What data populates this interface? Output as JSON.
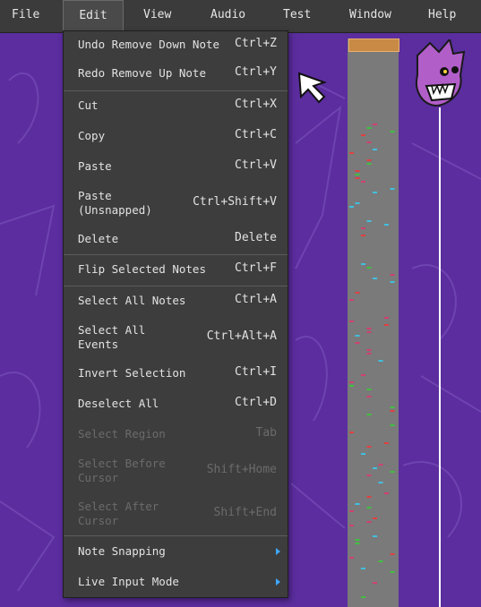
{
  "menubar": {
    "items": [
      "File",
      "Edit",
      "View",
      "Audio",
      "Test",
      "Window",
      "Help"
    ],
    "active": "Edit"
  },
  "edit_menu": {
    "items": [
      {
        "label": "Undo Remove Down Note",
        "shortcut": "Ctrl+Z",
        "enabled": true
      },
      {
        "label": "Redo Remove Up Note",
        "shortcut": "Ctrl+Y",
        "enabled": true
      },
      {
        "label": "Cut",
        "shortcut": "Ctrl+X",
        "enabled": true
      },
      {
        "label": "Copy",
        "shortcut": "Ctrl+C",
        "enabled": true
      },
      {
        "label": "Paste",
        "shortcut": "Ctrl+V",
        "enabled": true
      },
      {
        "label_line1": "Paste",
        "label_line2": "(Unsnapped)",
        "shortcut": "Ctrl+Shift+V",
        "enabled": true
      },
      {
        "label": "Delete",
        "shortcut": "Delete",
        "enabled": true
      },
      {
        "label": "Flip Selected Notes",
        "shortcut": "Ctrl+F",
        "enabled": true
      },
      {
        "label": "Select All Notes",
        "shortcut": "Ctrl+A",
        "enabled": true
      },
      {
        "label_line1": "Select All",
        "label_line2": "Events",
        "shortcut": "Ctrl+Alt+A",
        "enabled": true
      },
      {
        "label": "Invert Selection",
        "shortcut": "Ctrl+I",
        "enabled": true
      },
      {
        "label": "Deselect All",
        "shortcut": "Ctrl+D",
        "enabled": true
      },
      {
        "label": "Select Region",
        "shortcut": "Tab",
        "enabled": false
      },
      {
        "label_line1": "Select Before",
        "label_line2": "Cursor",
        "shortcut": "Shift+Home",
        "enabled": false
      },
      {
        "label_line1": "Select After",
        "label_line2": "Cursor",
        "shortcut": "Shift+End",
        "enabled": false
      },
      {
        "label": "Note Snapping",
        "submenu": true,
        "enabled": true
      },
      {
        "label": "Live Input Mode",
        "submenu": true,
        "enabled": true
      }
    ]
  },
  "colors": {
    "background": "#5b2d9e",
    "menubar": "#3b3b3b",
    "menu": "#3d3d3d",
    "submenu_arrow": "#3fa8ff"
  }
}
